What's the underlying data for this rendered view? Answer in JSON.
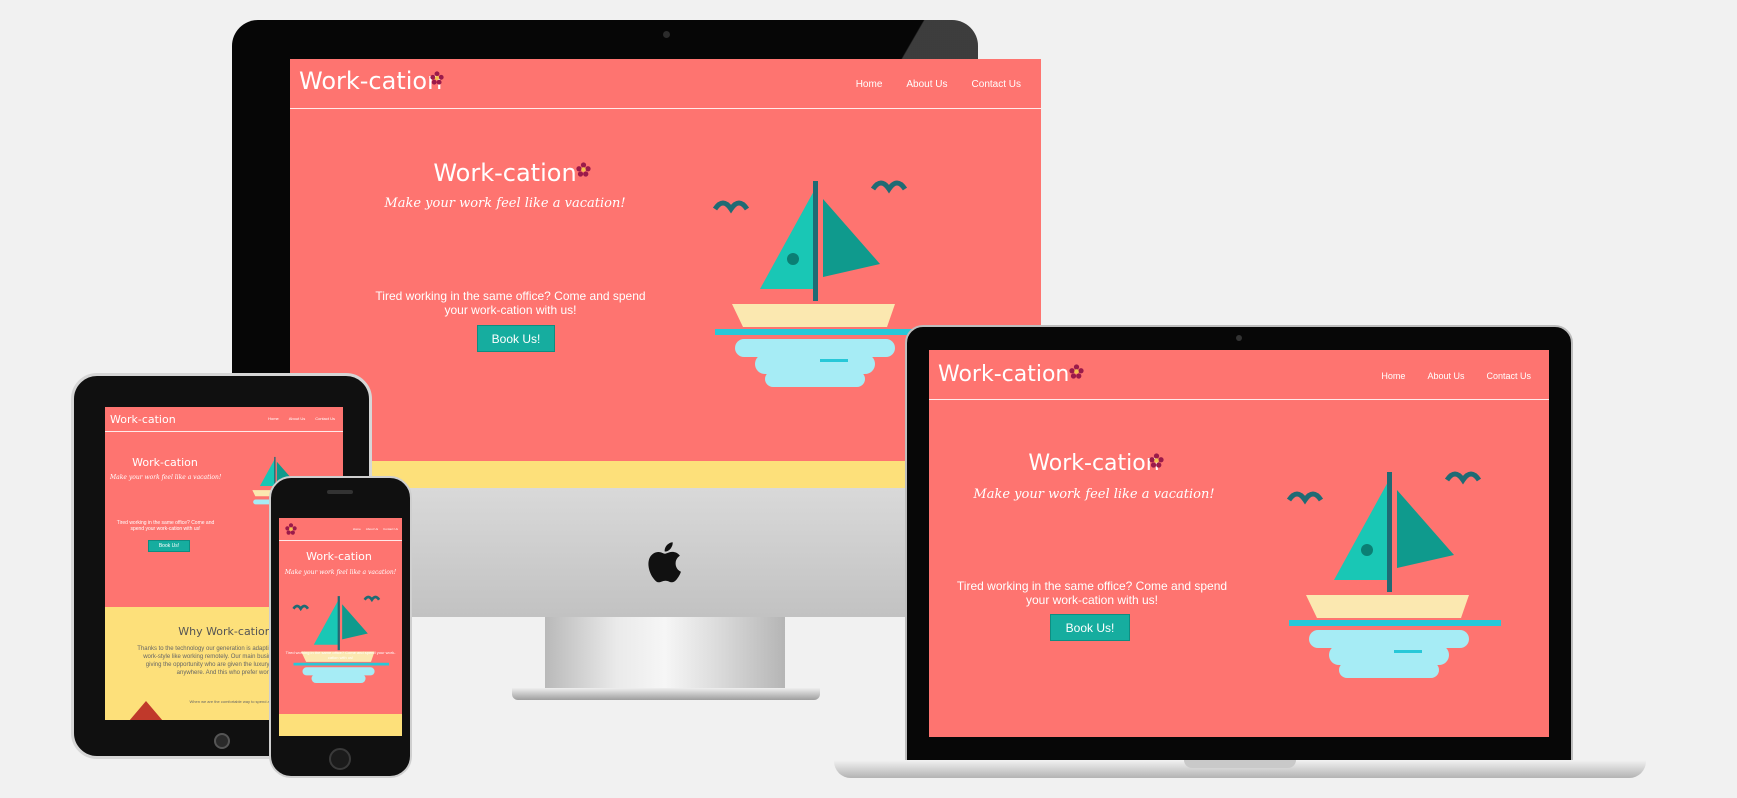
{
  "site": {
    "logo": "Work-cation",
    "nav": [
      "Home",
      "About Us",
      "Contact Us"
    ],
    "hero_title": "Work-cation",
    "tagline": "Make your work feel like a vacation!",
    "description": "Tired working in the same office? Come and spend your work-cation with us!",
    "cta": "Book Us!",
    "section_title": "Why Work-cation",
    "section_body": "Thanks to the technology our generation is adapting a new type of work-style like working remotely. Our main business becomes giving the opportunity who are given the luxury to work from anywhere. And this who prefer work.",
    "feature_text": "When we are the comfortable way to spend a new home."
  },
  "colors": {
    "coral": "#fe7470",
    "teal": "#16ad9f",
    "yellow": "#fde07a",
    "boat_sail": "#19c7b5",
    "boat_sail_dark": "#0f9a8d",
    "water": "#a6ecf5"
  },
  "devices": [
    "imac",
    "macbook",
    "ipad",
    "iphone"
  ],
  "icons": [
    "apple-logo-icon",
    "flower-icon",
    "sailboat-illustration",
    "seagull-icon"
  ]
}
